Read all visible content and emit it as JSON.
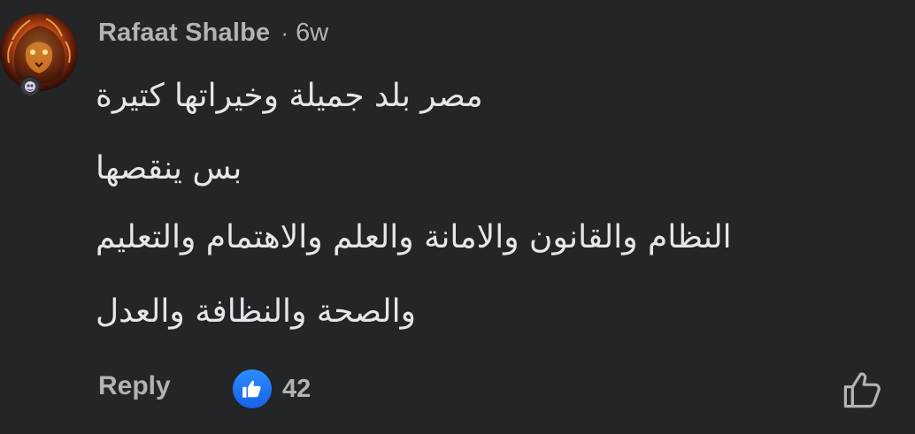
{
  "comment": {
    "author": "Rafaat Shalbe",
    "separator": "·",
    "time": "6w",
    "lines": [
      "مصر بلد جميلة وخيراتها كتيرة",
      "بس ينقصها",
      "النظام والقانون والامانة والعلم والاهتمام والتعليم",
      "والصحة والنظافة والعدل"
    ],
    "reply_label": "Reply",
    "reaction_count": "42"
  },
  "icons": {
    "avatar": "lion-avatar",
    "badge": "profile-badge-icon",
    "reaction": "like-reaction-icon",
    "like": "thumbs-up-outline-icon"
  },
  "colors": {
    "background": "#242527",
    "text_primary": "#e4e6eb",
    "text_secondary": "#b0b3b8",
    "like_blue": "#1f77f5"
  }
}
